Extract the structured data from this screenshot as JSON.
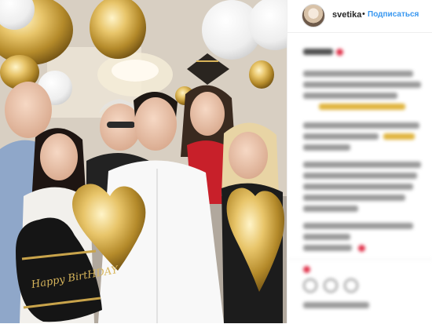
{
  "post": {
    "username": "svetika",
    "separator": "•",
    "follow_label": "Подписаться"
  },
  "photo_overlay": {
    "balloon_text": "Happy BirtHDAY"
  },
  "colors": {
    "follow_blue": "#3897f0",
    "like_red": "#e0334b"
  },
  "icons": [
    "avatar",
    "heart-icon",
    "comment-icon",
    "share-icon"
  ]
}
